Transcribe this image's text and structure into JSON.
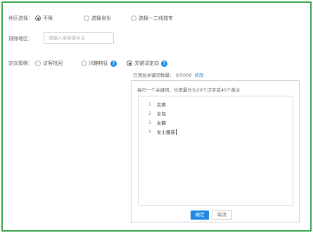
{
  "region": {
    "label": "地区选择：",
    "options": [
      "不限",
      "选择省份",
      "选择一二线城市"
    ]
  },
  "exclude": {
    "label": "排除地区：",
    "placeholder": "请输入拼音或中文"
  },
  "strategy": {
    "label": "定向策略：",
    "options": [
      "访客找回",
      "兴趣特征",
      "关键词定向"
    ],
    "help_glyph": "?"
  },
  "keywords": {
    "added_label": "已添加关键词数量：",
    "added_count": "0/5000",
    "edit_link": "修改",
    "hint": "每行一个关键词，长度最长为20个汉字或40个英文",
    "lines": [
      {
        "num": "1",
        "text": "女裤"
      },
      {
        "num": "2",
        "text": "女包"
      },
      {
        "num": "3",
        "text": "女鞋"
      },
      {
        "num": "4",
        "text": "女士服装"
      }
    ],
    "confirm_label": "确定",
    "cancel_label": "取消"
  },
  "colors": {
    "frame": "#3aa84a",
    "accent": "#1e88e5"
  }
}
